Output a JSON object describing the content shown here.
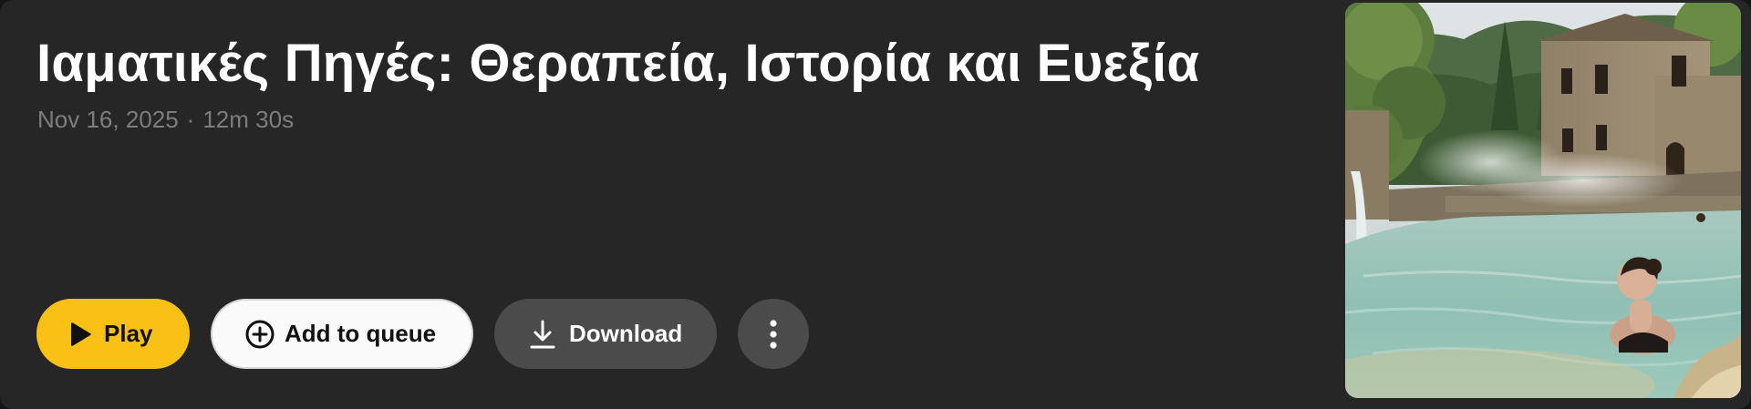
{
  "episode": {
    "title": "Ιαματικές Πηγές: Θεραπεία, Ιστορία και Ευεξία",
    "date": "Nov 16, 2025",
    "separator": "·",
    "duration": "12m 30s"
  },
  "actions": {
    "play_label": "Play",
    "queue_label": "Add to queue",
    "download_label": "Download"
  },
  "icons": {
    "play": "play-icon",
    "queue": "plus-circle-icon",
    "download": "download-icon",
    "more": "more-vertical-icon"
  },
  "colors": {
    "card_background": "#262626",
    "play_accent": "#f9c116",
    "secondary_button": "#4b4b4b",
    "meta_text": "#7d7d7d"
  }
}
